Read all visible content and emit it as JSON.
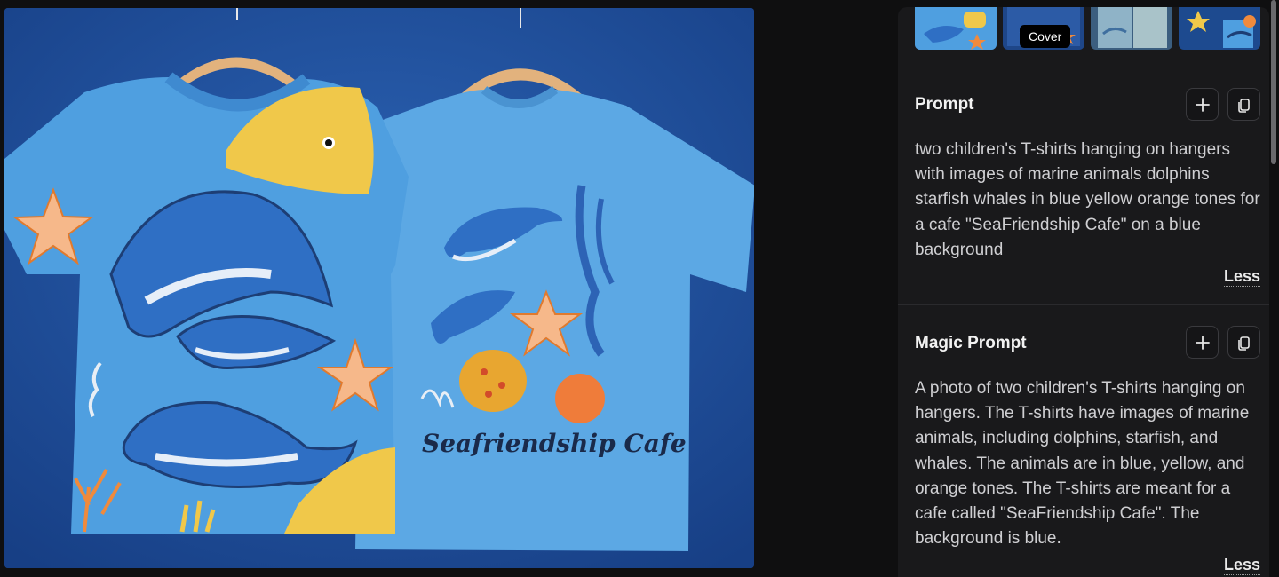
{
  "image": {
    "alt": "Seafriendship Cafe",
    "shirt_print_text": "Seafriendship Cafe"
  },
  "thumbnails": {
    "tooltip": "Cover",
    "items": [
      {
        "name": "thumbnail-1",
        "active": true
      },
      {
        "name": "thumbnail-2",
        "active": false
      },
      {
        "name": "thumbnail-3",
        "active": false
      },
      {
        "name": "thumbnail-4",
        "active": false
      }
    ]
  },
  "prompt": {
    "title": "Prompt",
    "text": "two children's T-shirts hanging on hangers with images of marine animals dolphins starfish whales in blue yellow orange tones for a cafe \"SeaFriendship Cafe\" on a blue background",
    "less_label": "Less",
    "add_icon": "plus-icon",
    "copy_icon": "copy-icon"
  },
  "magic_prompt": {
    "title": "Magic Prompt",
    "text": "A photo of two children's T-shirts hanging on hangers. The T-shirts have images of marine animals, including dolphins, starfish, and whales. The animals are in blue, yellow, and orange tones. The T-shirts are meant for a cafe called \"SeaFriendship Cafe\". The background is blue.",
    "less_label": "Less",
    "add_icon": "plus-icon",
    "copy_icon": "copy-icon"
  },
  "colors": {
    "background": "#0f0f10",
    "panel": "#19191b",
    "photo_backdrop": "#1f4e97",
    "shirt_blue": "#59a3e0",
    "accent_yellow": "#f0c84a",
    "accent_orange": "#f08a3c"
  }
}
